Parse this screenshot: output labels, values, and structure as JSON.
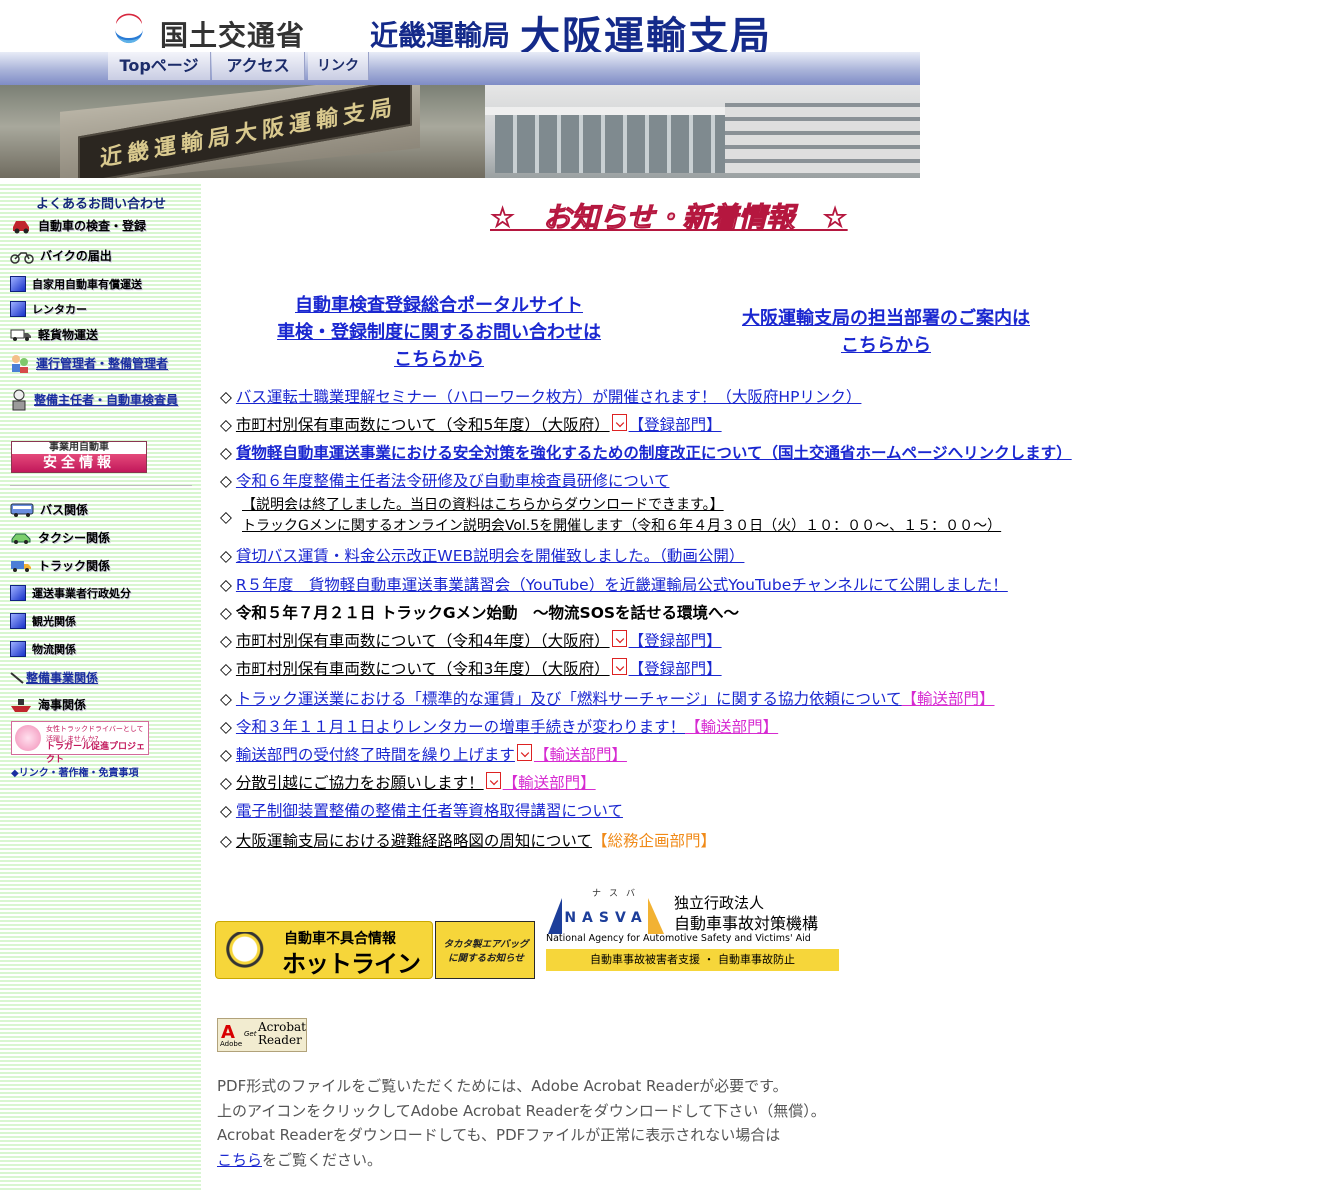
{
  "header": {
    "mlit_name": "国土交通省",
    "kinki_name": "近畿運輸局",
    "osaka_name": "大阪運輸支局",
    "nav": [
      "Topページ",
      "アクセス",
      "リンク"
    ],
    "sign_text": "近畿運輸局大阪運輸支局"
  },
  "sidebar": {
    "faq": "よくあるお問い合わせ",
    "items": [
      "自動車の検査・登録",
      "バイクの届出",
      "自家用自動車有償運送",
      "レンタカー",
      "軽貨物運送",
      "運行管理者・整備管理者",
      "整備主任者・自動車検査員"
    ],
    "safety_banner": {
      "top": "事業用自動車",
      "bottom": "安全情報"
    },
    "items2": [
      "バス関係",
      "タクシー関係",
      "トラック関係",
      "運送事業者行政処分",
      "観光関係",
      "物流関係",
      "整備事業関係",
      "海事関係"
    ],
    "toragal": {
      "line1": "女性トラックドライバーとして活躍しませんか?",
      "line2": "トラガール促進プロジェクト"
    },
    "footer": "◆リンク・著作権・免責事項"
  },
  "main": {
    "notice_title": "☆　お知らせ・新着情報　☆",
    "portal_link": [
      "自動車検査登録総合ポータルサイト",
      "車検・登録制度に関するお問い合わせは",
      "こちらから"
    ],
    "dept_link": [
      "大阪運輸支局の担当部署のご案内は",
      "こちらから"
    ],
    "news": [
      {
        "text": "バス運転士職業理解セミナー（ハローワーク枚方）が開催されます！（大阪府HPリンク）"
      },
      {
        "text": "市町村別保有車両数について（令和5年度）（大阪府）",
        "dept": "【登録部門】"
      },
      {
        "text": "貨物軽自動車運送事業における安全対策を強化するための制度改正について（国土交通省ホームページへリンクします）"
      },
      {
        "text": "令和６年度整備主任者法令研修及び自動車検査員研修について"
      },
      {
        "text": "【説明会は終了しました。当日の資料はこちらからダウンロードできます。】",
        "text2": "トラックGメンに関するオンライン説明会Vol.5を開催します（令和６年４月３０日（火）１０：００～、１５：００～）"
      },
      {
        "text": "貸切バス運賃・料金公示改正WEB説明会を開催致しました。（動画公開）"
      },
      {
        "text": "R５年度　貨物軽自動車運送事業講習会（YouTube）を近畿運輸局公式YouTubeチャンネルにて公開しました！"
      },
      {
        "text": "令和５年７月２１日 トラックGメン始動　～物流SOSを話せる環境へ～"
      },
      {
        "text": "市町村別保有車両数について（令和4年度）（大阪府）",
        "dept": "【登録部門】"
      },
      {
        "text": "市町村別保有車両数について（令和3年度）（大阪府）",
        "dept": "【登録部門】"
      },
      {
        "text": "トラック運送業における「標準的な運賃」及び「燃料サーチャージ」に関する協力依頼について",
        "dept": "【輸送部門】"
      },
      {
        "text": "令和３年１１月１日よりレンタカーの増車手続きが変わります！",
        "dept": "【輸送部門】"
      },
      {
        "text": "輸送部門の受付終了時間を繰り上げます",
        "dept": "【輸送部門】"
      },
      {
        "text": "分散引越にご協力をお願いします！",
        "dept": "【輸送部門】"
      },
      {
        "text": "電子制御装置整備の整備主任者等資格取得講習について"
      },
      {
        "text": "大阪運輸支局における避難経路略図の周知について",
        "dept": "【総務企画部門】"
      }
    ],
    "hotline": {
      "line1": "自動車不具合情報",
      "line2": "ホットライン"
    },
    "airbag": {
      "line1": "タカタ製エアバッグ",
      "line2": "に関するお知らせ"
    },
    "nasva": {
      "kana": "ナスバ",
      "logo": "NASVA",
      "jp1": "独立行政法人",
      "jp2": "自動車事故対策機構",
      "en": "National Agency for Automotive Safety and Victims' Aid",
      "bar": "自動車事故被害者支援 ・ 自動車事故防止"
    },
    "acrobat": {
      "adobe": "Adobe",
      "get": "Get",
      "word1": "Acrobat",
      "word2": "Reader"
    },
    "pdf_note": [
      "PDF形式のファイルをご覧いただくためには、Adobe Acrobat Readerが必要です。",
      "上のアイコンをクリックしてAdobe Acrobat Readerをダウンロードして下さい（無償）。",
      "Acrobat Readerをダウンロードしても、PDFファイルが正常に表示されない場合は"
    ],
    "pdf_note_link": "こちら",
    "pdf_note_tail": "をご覧ください。"
  },
  "colors": {
    "link": "#1a27d0",
    "dept_magenta": "#d62ad1",
    "dept_orange": "#f08a18",
    "title_red": "#b5173f"
  }
}
